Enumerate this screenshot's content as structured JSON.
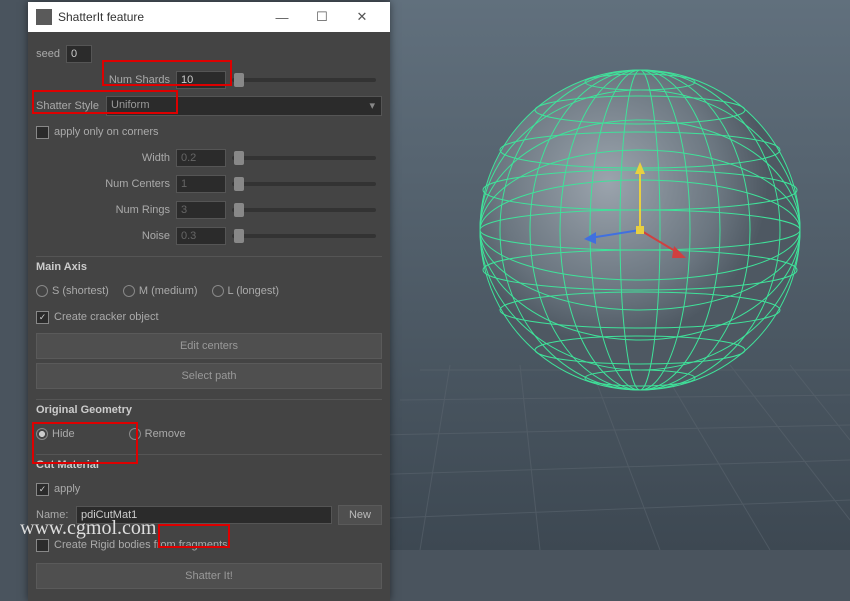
{
  "window": {
    "title": "ShatterIt feature"
  },
  "seed": {
    "label": "seed",
    "value": "0"
  },
  "numShards": {
    "label": "Num Shards",
    "value": "10"
  },
  "shatterStyle": {
    "label": "Shatter Style",
    "value": "Uniform"
  },
  "applyCorners": {
    "label": "apply only on corners"
  },
  "width": {
    "label": "Width",
    "value": "0.2"
  },
  "numCenters": {
    "label": "Num Centers",
    "value": "1"
  },
  "numRings": {
    "label": "Num Rings",
    "value": "3"
  },
  "noise": {
    "label": "Noise",
    "value": "0.3"
  },
  "mainAxis": {
    "title": "Main Axis",
    "s": "S (shortest)",
    "m": "M (medium)",
    "l": "L (longest)"
  },
  "cracker": {
    "label": "Create cracker object"
  },
  "editCenters": "Edit centers",
  "selectPath": "Select path",
  "origGeo": {
    "title": "Original Geometry",
    "hide": "Hide",
    "remove": "Remove"
  },
  "cutMat": {
    "title": "Cut Material",
    "apply": "apply",
    "nameLabel": "Name:",
    "name": "pdiCutMat1",
    "new": "New"
  },
  "rigid": {
    "label": "Create Rigid bodies from fragments"
  },
  "shatterBtn": "Shatter It!",
  "watermark": "www.cgmol.com"
}
